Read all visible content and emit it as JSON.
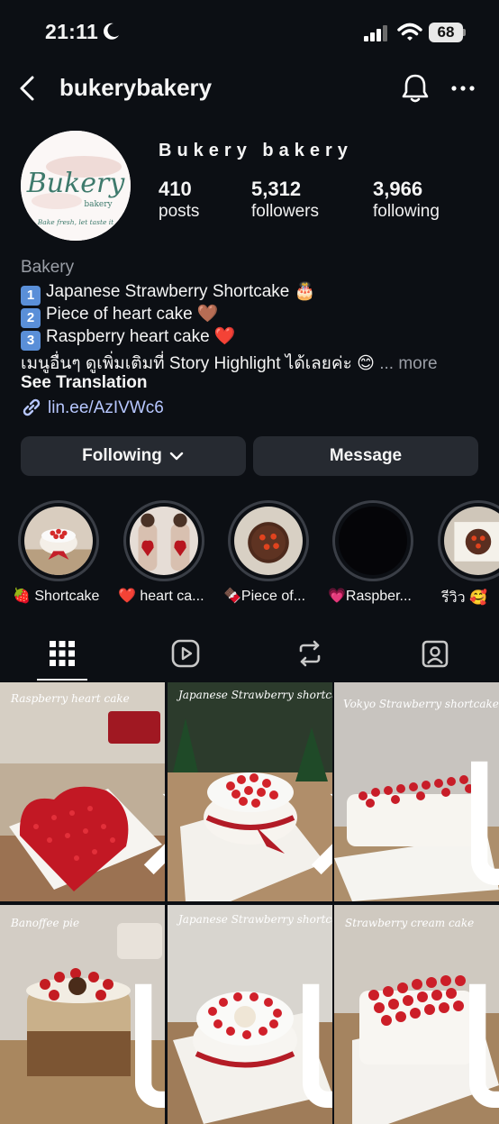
{
  "status": {
    "time": "21:11",
    "battery": "68"
  },
  "header": {
    "username": "bukerybakery"
  },
  "profile": {
    "display_name": "Bukery bakery",
    "avatar_text": "Bukery",
    "avatar_sub": "bakery",
    "avatar_tagline": "Bake fresh, let taste it",
    "stats": [
      {
        "value": "410",
        "label": "posts"
      },
      {
        "value": "5,312",
        "label": "followers"
      },
      {
        "value": "3,966",
        "label": "following"
      }
    ]
  },
  "bio": {
    "category": "Bakery",
    "items": [
      {
        "num": "1",
        "text": "Japanese Strawberry Shortcake 🎂"
      },
      {
        "num": "2",
        "text": "Piece of heart cake 🤎"
      },
      {
        "num": "3",
        "text": "Raspberry heart cake ❤️"
      }
    ],
    "line4": "เมนูอื่นๆ ดูเพิ่มเติมที่ Story Highlight ได้เลยค่ะ 😊",
    "more": "... more",
    "see_translation": "See Translation",
    "link": "lin.ee/AzIVWc6"
  },
  "buttons": {
    "following": "Following",
    "message": "Message"
  },
  "highlights": [
    {
      "label": "🍓 Shortcake"
    },
    {
      "label": "❤️ heart ca..."
    },
    {
      "label": "🍫Piece of..."
    },
    {
      "label": "💗Raspber..."
    },
    {
      "label": "รีวิว 🥰"
    }
  ],
  "posts": [
    {
      "title": "Raspberry heart cake"
    },
    {
      "title": "Japanese Strawberry shortcake"
    },
    {
      "title": "Vokyo Strawberry shortcake"
    },
    {
      "title": "Banoffee pie"
    },
    {
      "title": "Japanese Strawberry shortcake"
    },
    {
      "title": "Strawberry cream cake"
    }
  ],
  "colors": {
    "background": "#0c0f14",
    "button": "#262a31",
    "link": "#b7c7ff",
    "muted": "#9a9ea6"
  }
}
